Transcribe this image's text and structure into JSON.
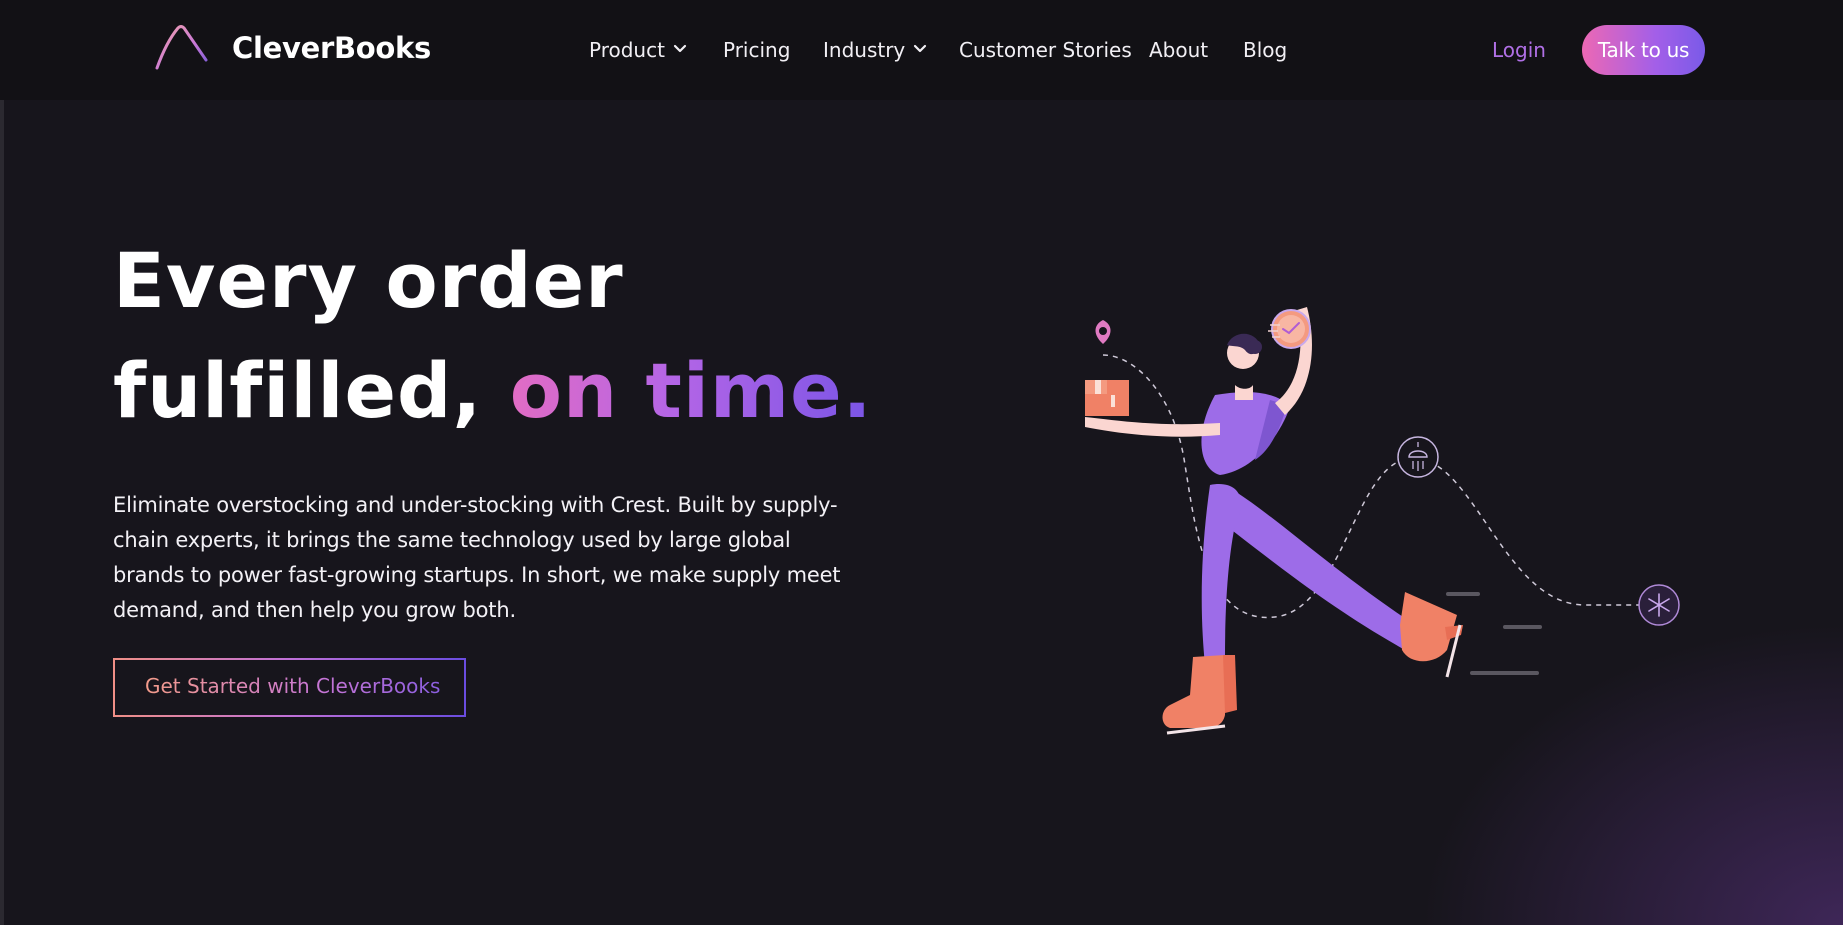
{
  "brand": {
    "name": "CleverBooks",
    "logo_icon": "triangle-logo-icon"
  },
  "nav": {
    "items": [
      {
        "label": "Product",
        "has_dropdown": true
      },
      {
        "label": "Pricing",
        "has_dropdown": false
      },
      {
        "label": "Industry",
        "has_dropdown": true
      },
      {
        "label": "Customer Stories",
        "has_dropdown": false
      },
      {
        "label": "About",
        "has_dropdown": false
      },
      {
        "label": "Blog",
        "has_dropdown": false
      }
    ],
    "login_label": "Login",
    "cta_label": "Talk to us"
  },
  "hero": {
    "headline_line1": "Every order",
    "headline_line2_plain": "fulfilled,",
    "headline_line2_accent": "on time.",
    "description": "Eliminate overstocking and under-stocking with Crest. Built by supply-chain experts, it brings the same technology used by large global brands to power fast-growing startups. In short, we make supply meet demand, and then help you grow both.",
    "cta_label": "Get Started with CleverBooks"
  },
  "illustration": {
    "icons": [
      "location-pin-icon",
      "package-icon",
      "clock-icon",
      "rain-weather-icon",
      "snowflake-icon"
    ]
  },
  "colors": {
    "background": "#17151c",
    "nav_background": "#121115",
    "accent_pink": "#ec68b4",
    "accent_purple": "#a35fe8",
    "figure_purple": "#9d6ce8",
    "figure_coral": "#f08166"
  }
}
